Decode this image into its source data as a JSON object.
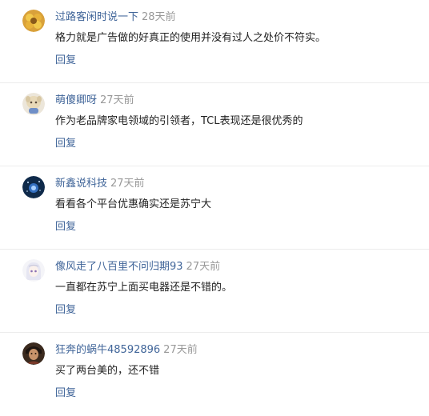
{
  "comments": [
    {
      "username": "过路客闲时说一下",
      "time": "28天前",
      "content": "格力就是广告做的好真正的使用并没有过人之处价不符实。",
      "reply_label": "回复"
    },
    {
      "username": "萌傻卿呀",
      "time": "27天前",
      "content": "作为老品牌家电领域的引领者，TCL表现还是很优秀的",
      "reply_label": "回复"
    },
    {
      "username": "新鑫说科技",
      "time": "27天前",
      "content": "看看各个平台优惠确实还是苏宁大",
      "reply_label": "回复"
    },
    {
      "username": "像风走了八百里不问归期93",
      "time": "27天前",
      "content": "一直都在苏宁上面买电器还是不错的。",
      "reply_label": "回复"
    },
    {
      "username": "狂奔的蜗牛48592896",
      "time": "27天前",
      "content": "买了两台美的，还不错",
      "reply_label": "回复"
    }
  ]
}
